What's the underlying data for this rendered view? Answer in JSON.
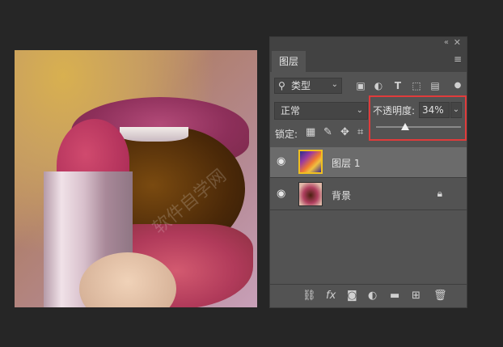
{
  "panel": {
    "tab_label": "图层",
    "collapse_icon": "double-chevron-icon",
    "close_icon": "close-icon",
    "menu_icon": "menu-icon",
    "filter": {
      "icon": "search-icon",
      "value": "类型"
    },
    "filter_buttons": [
      "image-filter-icon",
      "adjustment-filter-icon",
      "text-filter-icon",
      "shape-filter-icon",
      "smart-object-filter-icon"
    ],
    "blend_mode": "正常",
    "opacity_label": "不透明度:",
    "opacity_value": "34%",
    "opacity_fraction": 0.34,
    "lock_label": "锁定:",
    "layers": [
      {
        "name": "图层 1",
        "selected": true,
        "visible": true,
        "locked": false
      },
      {
        "name": "背景",
        "selected": false,
        "visible": true,
        "locked": true
      }
    ],
    "bottom_icons": [
      "link-layers-icon",
      "fx-icon",
      "add-mask-icon",
      "adjustment-layer-icon",
      "new-group-icon",
      "new-layer-icon",
      "delete-icon"
    ],
    "highlight_color": "#e03b3b"
  },
  "canvas": {
    "watermark": "软件自学网"
  }
}
